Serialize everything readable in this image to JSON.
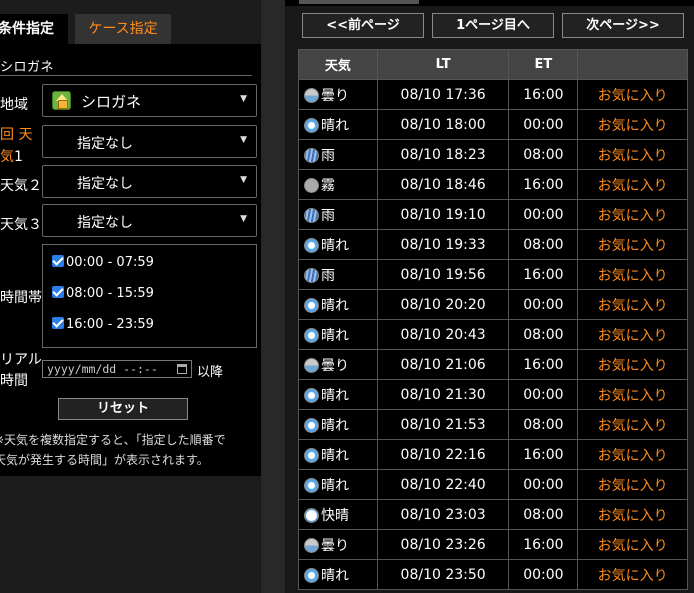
{
  "tabs": {
    "condition": "条件指定",
    "case": "ケース指定"
  },
  "region_title": "シロガネ",
  "form": {
    "area_label": "地域",
    "area_value": "シロガネ",
    "weather1_label_a": "回",
    "weather1_label_b": "天",
    "weather1_label_c": "気",
    "weather1_label_num": "1",
    "weather1_value": "指定なし",
    "weather2_label": "天気２",
    "weather2_value": "指定なし",
    "weather3_label": "天気３",
    "weather3_value": "指定なし",
    "time_label": "時間帯",
    "time_slots": [
      "00:00 - 07:59",
      "08:00 - 15:59",
      "16:00 - 23:59"
    ],
    "real_label_a": "リアル",
    "real_label_b": "時間",
    "date_placeholder": "yyyy/mm/dd --:--",
    "after_label": "以降",
    "reset_label": "リセット",
    "note_line1": "※天気を複数指定すると、「指定した順番で",
    "note_line2": "天気が発生する時間」が表示されます。"
  },
  "nav": {
    "prev": "<<前ページ",
    "first": "1ページ目へ",
    "next": "次ページ>>"
  },
  "table": {
    "headers": [
      "天気",
      "LT",
      "ET",
      ""
    ],
    "fav_label": "お気に入り",
    "rows": [
      {
        "icon": "cloudy-icon",
        "weather": "曇り",
        "lt": "08/10 17:36",
        "et": "16:00"
      },
      {
        "icon": "sunny-icon",
        "weather": "晴れ",
        "lt": "08/10 18:00",
        "et": "00:00"
      },
      {
        "icon": "rain-icon",
        "weather": "雨",
        "lt": "08/10 18:23",
        "et": "08:00"
      },
      {
        "icon": "fog-icon",
        "weather": "霧",
        "lt": "08/10 18:46",
        "et": "16:00"
      },
      {
        "icon": "rain-icon",
        "weather": "雨",
        "lt": "08/10 19:10",
        "et": "00:00"
      },
      {
        "icon": "sunny-icon",
        "weather": "晴れ",
        "lt": "08/10 19:33",
        "et": "08:00"
      },
      {
        "icon": "rain-icon",
        "weather": "雨",
        "lt": "08/10 19:56",
        "et": "16:00"
      },
      {
        "icon": "sunny-icon",
        "weather": "晴れ",
        "lt": "08/10 20:20",
        "et": "00:00"
      },
      {
        "icon": "sunny-icon",
        "weather": "晴れ",
        "lt": "08/10 20:43",
        "et": "08:00"
      },
      {
        "icon": "cloudy-icon",
        "weather": "曇り",
        "lt": "08/10 21:06",
        "et": "16:00"
      },
      {
        "icon": "sunny-icon",
        "weather": "晴れ",
        "lt": "08/10 21:30",
        "et": "00:00"
      },
      {
        "icon": "sunny-icon",
        "weather": "晴れ",
        "lt": "08/10 21:53",
        "et": "08:00"
      },
      {
        "icon": "sunny-icon",
        "weather": "晴れ",
        "lt": "08/10 22:16",
        "et": "16:00"
      },
      {
        "icon": "sunny-icon",
        "weather": "晴れ",
        "lt": "08/10 22:40",
        "et": "00:00"
      },
      {
        "icon": "clear-icon",
        "weather": "快晴",
        "lt": "08/10 23:03",
        "et": "08:00"
      },
      {
        "icon": "cloudy-icon",
        "weather": "曇り",
        "lt": "08/10 23:26",
        "et": "16:00"
      },
      {
        "icon": "sunny-icon",
        "weather": "晴れ",
        "lt": "08/10 23:50",
        "et": "00:00"
      }
    ]
  },
  "colors": {
    "accent": "#ff8c1a",
    "checkbox": "#2a7ee6"
  }
}
